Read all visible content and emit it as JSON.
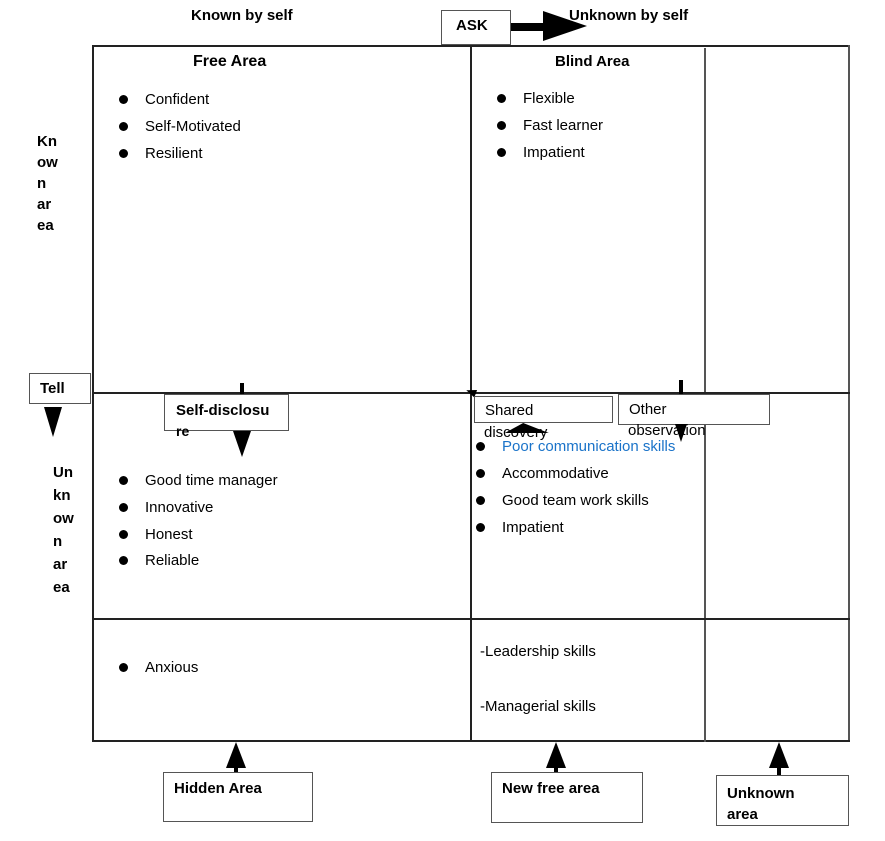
{
  "header": {
    "known_by_self": "Known by self",
    "unknown_by_self": "Unknown by self",
    "ask_label": "ASK"
  },
  "side": {
    "known_area": [
      "Kn",
      "ow",
      "n",
      "ar",
      "ea"
    ],
    "unknown_area": [
      "Un",
      "kn",
      "ow",
      "n",
      "ar",
      "ea"
    ],
    "tell_label": "Tell"
  },
  "free_area": {
    "title": "Free Area",
    "items": [
      "Confident",
      "Self-Motivated",
      "Resilient"
    ]
  },
  "blind_area": {
    "title": "Blind Area",
    "items": [
      "Flexible",
      "Fast learner",
      "Impatient"
    ]
  },
  "connectors": {
    "self_disclosure": [
      "Self-disclosu",
      "re"
    ],
    "shared_discovery": [
      "Shared",
      "discovery"
    ],
    "other_observation": [
      "Other",
      "observation"
    ]
  },
  "hidden_quadrant": {
    "items": [
      "Good time manager",
      "Innovative",
      "Honest",
      "Reliable"
    ]
  },
  "new_free_quadrant": {
    "highlight_color": "#1a73c9",
    "items": [
      "Poor communication skills",
      "Accommodative",
      "Good team work skills",
      "Impatient"
    ]
  },
  "bottom_left": {
    "items": [
      "Anxious"
    ]
  },
  "bottom_middle": {
    "items": [
      "-Leadership skills",
      "-Managerial skills"
    ]
  },
  "footer_boxes": {
    "hidden_area": "Hidden Area",
    "new_free_area": "New free area",
    "unknown_area": [
      "Unknown",
      "area"
    ]
  }
}
